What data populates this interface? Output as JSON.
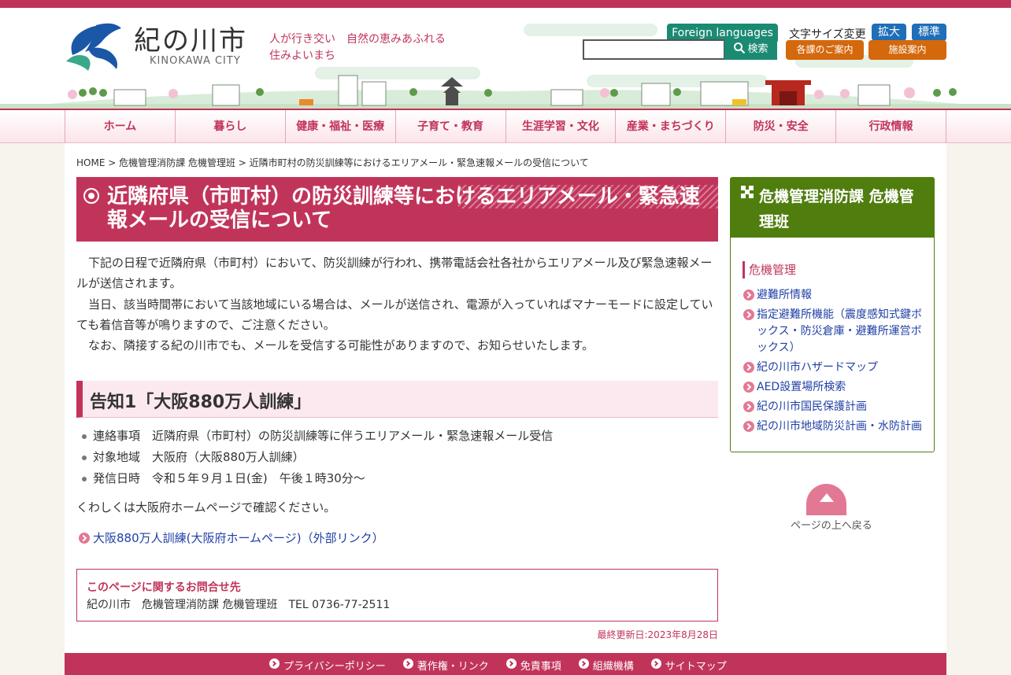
{
  "site": {
    "name": "紀の川市",
    "name_en": "KINOKAWA CITY",
    "tagline": "人が行き交い　自然の恵みあふれる　住みよいまち"
  },
  "header": {
    "foreign_languages": "Foreign languages",
    "font_size_label": "文字サイズ変更",
    "font_size_large": "拡大",
    "font_size_standard": "標準",
    "search_button": "検索",
    "search_value": "",
    "departments_button": "各課のご案内",
    "facilities_button": "施設案内"
  },
  "global_nav": {
    "items": [
      {
        "label": "ホーム"
      },
      {
        "label": "暮らし"
      },
      {
        "label": "健康・福祉・医療"
      },
      {
        "label": "子育て・教育"
      },
      {
        "label": "生涯学習・文化"
      },
      {
        "label": "産業・まちづくり"
      },
      {
        "label": "防災・安全"
      },
      {
        "label": "行政情報"
      }
    ]
  },
  "breadcrumb": {
    "home": "HOME",
    "sep": ">",
    "section": "危機管理消防課 危機管理班",
    "current": "近隣市町村の防災訓練等におけるエリアメール・緊急速報メールの受信について"
  },
  "article": {
    "title": "近隣府県（市町村）の防災訓練等におけるエリアメール・緊急速報メールの受信について",
    "paragraphs": [
      "　下記の日程で近隣府県（市町村）において、防災訓練が行われ、携帯電話会社各社からエリアメール及び緊急速報メールが送信されます。",
      "　当日、該当時間帯において当該地域にいる場合は、メールが送信され、電源が入っていればマナーモードに設定していても着信音等が鳴りますので、ご注意ください。",
      "　なお、隣接する紀の川市でも、メールを受信する可能性がありますので、お知らせいたします。"
    ],
    "section_heading": "告知1「大阪880万人訓練」",
    "details": [
      "連絡事項　近隣府県（市町村）の防災訓練等に伴うエリアメール・緊急速報メール受信",
      "対象地域　大阪府（大阪880万人訓練）",
      "発信日時　令和５年９月１日(金)　午後１時30分～"
    ],
    "more_info": "くわしくは大阪府ホームページで確認ください。",
    "external_link": "大阪880万人訓練(大阪府ホームページ)（外部リンク）"
  },
  "contact": {
    "title": "このページに関するお問合せ先",
    "body": "紀の川市　危機管理消防課 危機管理班　TEL 0736-77-2511"
  },
  "last_updated": "最終更新日:2023年8月28日",
  "sidebar": {
    "heading": "危機管理消防課 危機管理班",
    "subheading": "危機管理",
    "links": [
      "避難所情報",
      "指定避難所機能（震度感知式鍵ボックス・防災倉庫・避難所運営ボックス）",
      "紀の川市ハザードマップ",
      "AED設置場所検索",
      "紀の川市国民保護計画",
      "紀の川市地域防災計画・水防計画"
    ]
  },
  "page_top": "ページの上へ戻る",
  "footer": {
    "links": [
      "プライバシーポリシー",
      "著作権・リンク",
      "免責事項",
      "組織機構",
      "サイトマップ"
    ]
  },
  "colors": {
    "brand": "#c1345a",
    "green": "#1b8a73",
    "side_green": "#4f7e0e",
    "blue": "#1f6eb8",
    "orange": "#d4680d",
    "link": "#1f3fa6"
  }
}
